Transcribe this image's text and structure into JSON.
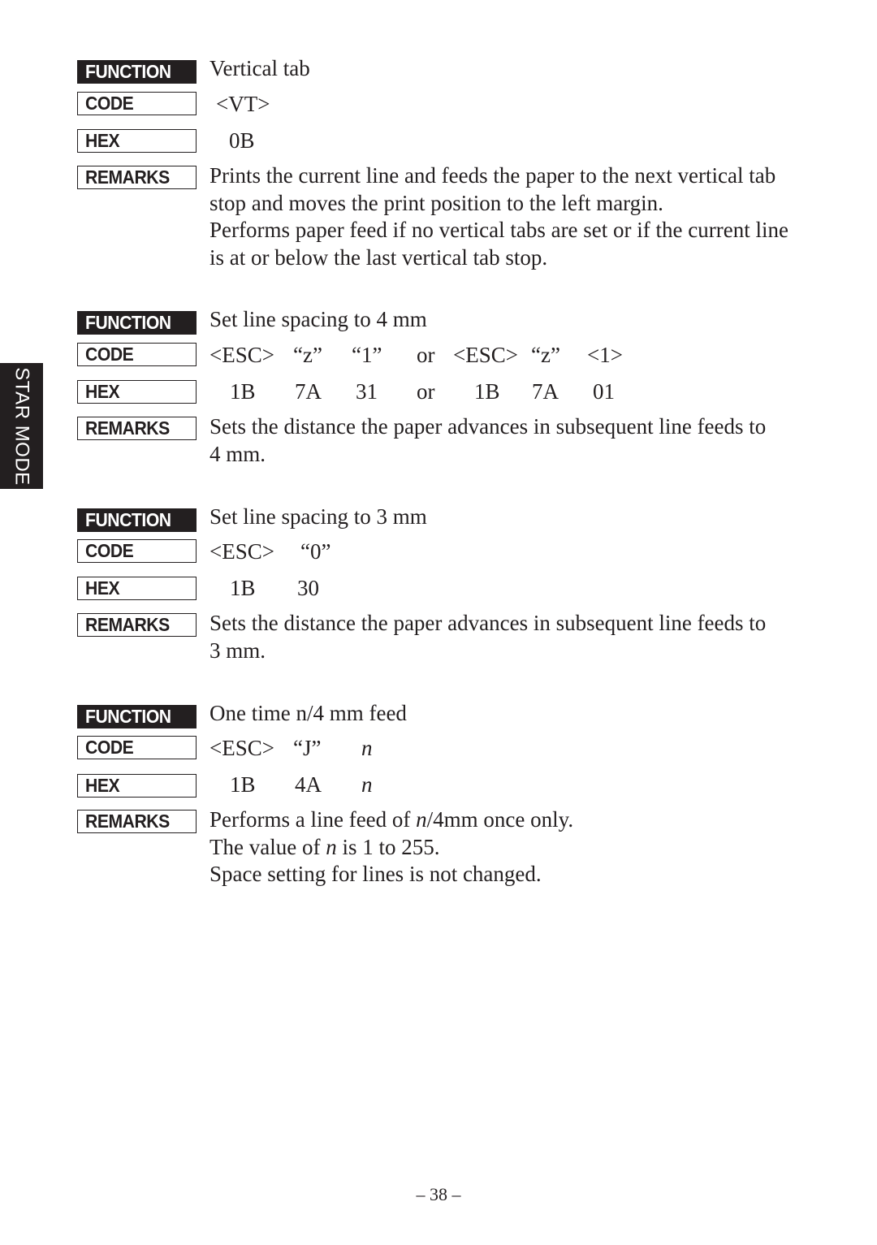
{
  "side_tab": {
    "label": "STAR MODE"
  },
  "labels": {
    "function": "FUNCTION",
    "code": "CODE",
    "hex": "HEX",
    "remarks": "REMARKS"
  },
  "commands": [
    {
      "function": "Vertical tab",
      "code": [
        "<VT>"
      ],
      "hex": [
        "0B"
      ],
      "remarks": [
        "Prints the current line and feeds the paper to the next vertical tab",
        "stop and moves the print position to the left margin.",
        "Performs paper feed if no vertical tabs are set or if the current line",
        "is at or below the last vertical tab stop."
      ]
    },
    {
      "function": "Set line spacing to 4 mm",
      "code": [
        "<ESC>",
        "“z”",
        "“1”",
        "or",
        "<ESC>",
        "“z”",
        "<1>"
      ],
      "hex": [
        "1B",
        "7A",
        "31",
        "or",
        "1B",
        "7A",
        "01"
      ],
      "remarks": [
        "Sets the distance the paper advances in subsequent line feeds to",
        "4 mm."
      ]
    },
    {
      "function": "Set line spacing to 3 mm",
      "code": [
        "<ESC>",
        "“0”"
      ],
      "hex": [
        "1B",
        "30"
      ],
      "remarks": [
        "Sets the distance the paper advances in subsequent line feeds to",
        "3 mm."
      ]
    },
    {
      "function": "One time n/4 mm feed",
      "code": [
        "<ESC>",
        "“J”",
        "n"
      ],
      "hex": [
        "1B",
        "4A",
        "n"
      ],
      "remarks_rich": [
        {
          "pre": "Performs a line feed of ",
          "var": "n",
          "post": "/4mm once only."
        },
        {
          "pre": "The value of ",
          "var": "n",
          "post": " is 1 to 255."
        },
        {
          "pre": "Space setting for lines is not changed.",
          "var": "",
          "post": ""
        }
      ]
    }
  ],
  "page_number": "– 38 –"
}
